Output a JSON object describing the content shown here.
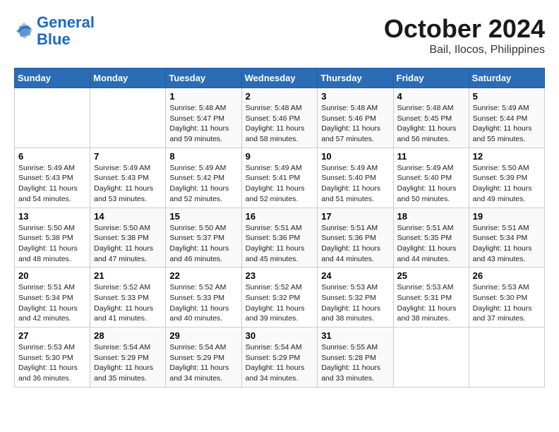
{
  "logo": {
    "line1": "General",
    "line2": "Blue"
  },
  "title": "October 2024",
  "subtitle": "Bail, Ilocos, Philippines",
  "days_of_week": [
    "Sunday",
    "Monday",
    "Tuesday",
    "Wednesday",
    "Thursday",
    "Friday",
    "Saturday"
  ],
  "weeks": [
    [
      {
        "day": "",
        "info": ""
      },
      {
        "day": "",
        "info": ""
      },
      {
        "day": "1",
        "info": "Sunrise: 5:48 AM\nSunset: 5:47 PM\nDaylight: 11 hours\nand 59 minutes."
      },
      {
        "day": "2",
        "info": "Sunrise: 5:48 AM\nSunset: 5:46 PM\nDaylight: 11 hours\nand 58 minutes."
      },
      {
        "day": "3",
        "info": "Sunrise: 5:48 AM\nSunset: 5:46 PM\nDaylight: 11 hours\nand 57 minutes."
      },
      {
        "day": "4",
        "info": "Sunrise: 5:48 AM\nSunset: 5:45 PM\nDaylight: 11 hours\nand 56 minutes."
      },
      {
        "day": "5",
        "info": "Sunrise: 5:49 AM\nSunset: 5:44 PM\nDaylight: 11 hours\nand 55 minutes."
      }
    ],
    [
      {
        "day": "6",
        "info": "Sunrise: 5:49 AM\nSunset: 5:43 PM\nDaylight: 11 hours\nand 54 minutes."
      },
      {
        "day": "7",
        "info": "Sunrise: 5:49 AM\nSunset: 5:43 PM\nDaylight: 11 hours\nand 53 minutes."
      },
      {
        "day": "8",
        "info": "Sunrise: 5:49 AM\nSunset: 5:42 PM\nDaylight: 11 hours\nand 52 minutes."
      },
      {
        "day": "9",
        "info": "Sunrise: 5:49 AM\nSunset: 5:41 PM\nDaylight: 11 hours\nand 52 minutes."
      },
      {
        "day": "10",
        "info": "Sunrise: 5:49 AM\nSunset: 5:40 PM\nDaylight: 11 hours\nand 51 minutes."
      },
      {
        "day": "11",
        "info": "Sunrise: 5:49 AM\nSunset: 5:40 PM\nDaylight: 11 hours\nand 50 minutes."
      },
      {
        "day": "12",
        "info": "Sunrise: 5:50 AM\nSunset: 5:39 PM\nDaylight: 11 hours\nand 49 minutes."
      }
    ],
    [
      {
        "day": "13",
        "info": "Sunrise: 5:50 AM\nSunset: 5:38 PM\nDaylight: 11 hours\nand 48 minutes."
      },
      {
        "day": "14",
        "info": "Sunrise: 5:50 AM\nSunset: 5:38 PM\nDaylight: 11 hours\nand 47 minutes."
      },
      {
        "day": "15",
        "info": "Sunrise: 5:50 AM\nSunset: 5:37 PM\nDaylight: 11 hours\nand 46 minutes."
      },
      {
        "day": "16",
        "info": "Sunrise: 5:51 AM\nSunset: 5:36 PM\nDaylight: 11 hours\nand 45 minutes."
      },
      {
        "day": "17",
        "info": "Sunrise: 5:51 AM\nSunset: 5:36 PM\nDaylight: 11 hours\nand 44 minutes."
      },
      {
        "day": "18",
        "info": "Sunrise: 5:51 AM\nSunset: 5:35 PM\nDaylight: 11 hours\nand 44 minutes."
      },
      {
        "day": "19",
        "info": "Sunrise: 5:51 AM\nSunset: 5:34 PM\nDaylight: 11 hours\nand 43 minutes."
      }
    ],
    [
      {
        "day": "20",
        "info": "Sunrise: 5:51 AM\nSunset: 5:34 PM\nDaylight: 11 hours\nand 42 minutes."
      },
      {
        "day": "21",
        "info": "Sunrise: 5:52 AM\nSunset: 5:33 PM\nDaylight: 11 hours\nand 41 minutes."
      },
      {
        "day": "22",
        "info": "Sunrise: 5:52 AM\nSunset: 5:33 PM\nDaylight: 11 hours\nand 40 minutes."
      },
      {
        "day": "23",
        "info": "Sunrise: 5:52 AM\nSunset: 5:32 PM\nDaylight: 11 hours\nand 39 minutes."
      },
      {
        "day": "24",
        "info": "Sunrise: 5:53 AM\nSunset: 5:32 PM\nDaylight: 11 hours\nand 38 minutes."
      },
      {
        "day": "25",
        "info": "Sunrise: 5:53 AM\nSunset: 5:31 PM\nDaylight: 11 hours\nand 38 minutes."
      },
      {
        "day": "26",
        "info": "Sunrise: 5:53 AM\nSunset: 5:30 PM\nDaylight: 11 hours\nand 37 minutes."
      }
    ],
    [
      {
        "day": "27",
        "info": "Sunrise: 5:53 AM\nSunset: 5:30 PM\nDaylight: 11 hours\nand 36 minutes."
      },
      {
        "day": "28",
        "info": "Sunrise: 5:54 AM\nSunset: 5:29 PM\nDaylight: 11 hours\nand 35 minutes."
      },
      {
        "day": "29",
        "info": "Sunrise: 5:54 AM\nSunset: 5:29 PM\nDaylight: 11 hours\nand 34 minutes."
      },
      {
        "day": "30",
        "info": "Sunrise: 5:54 AM\nSunset: 5:29 PM\nDaylight: 11 hours\nand 34 minutes."
      },
      {
        "day": "31",
        "info": "Sunrise: 5:55 AM\nSunset: 5:28 PM\nDaylight: 11 hours\nand 33 minutes."
      },
      {
        "day": "",
        "info": ""
      },
      {
        "day": "",
        "info": ""
      }
    ]
  ]
}
